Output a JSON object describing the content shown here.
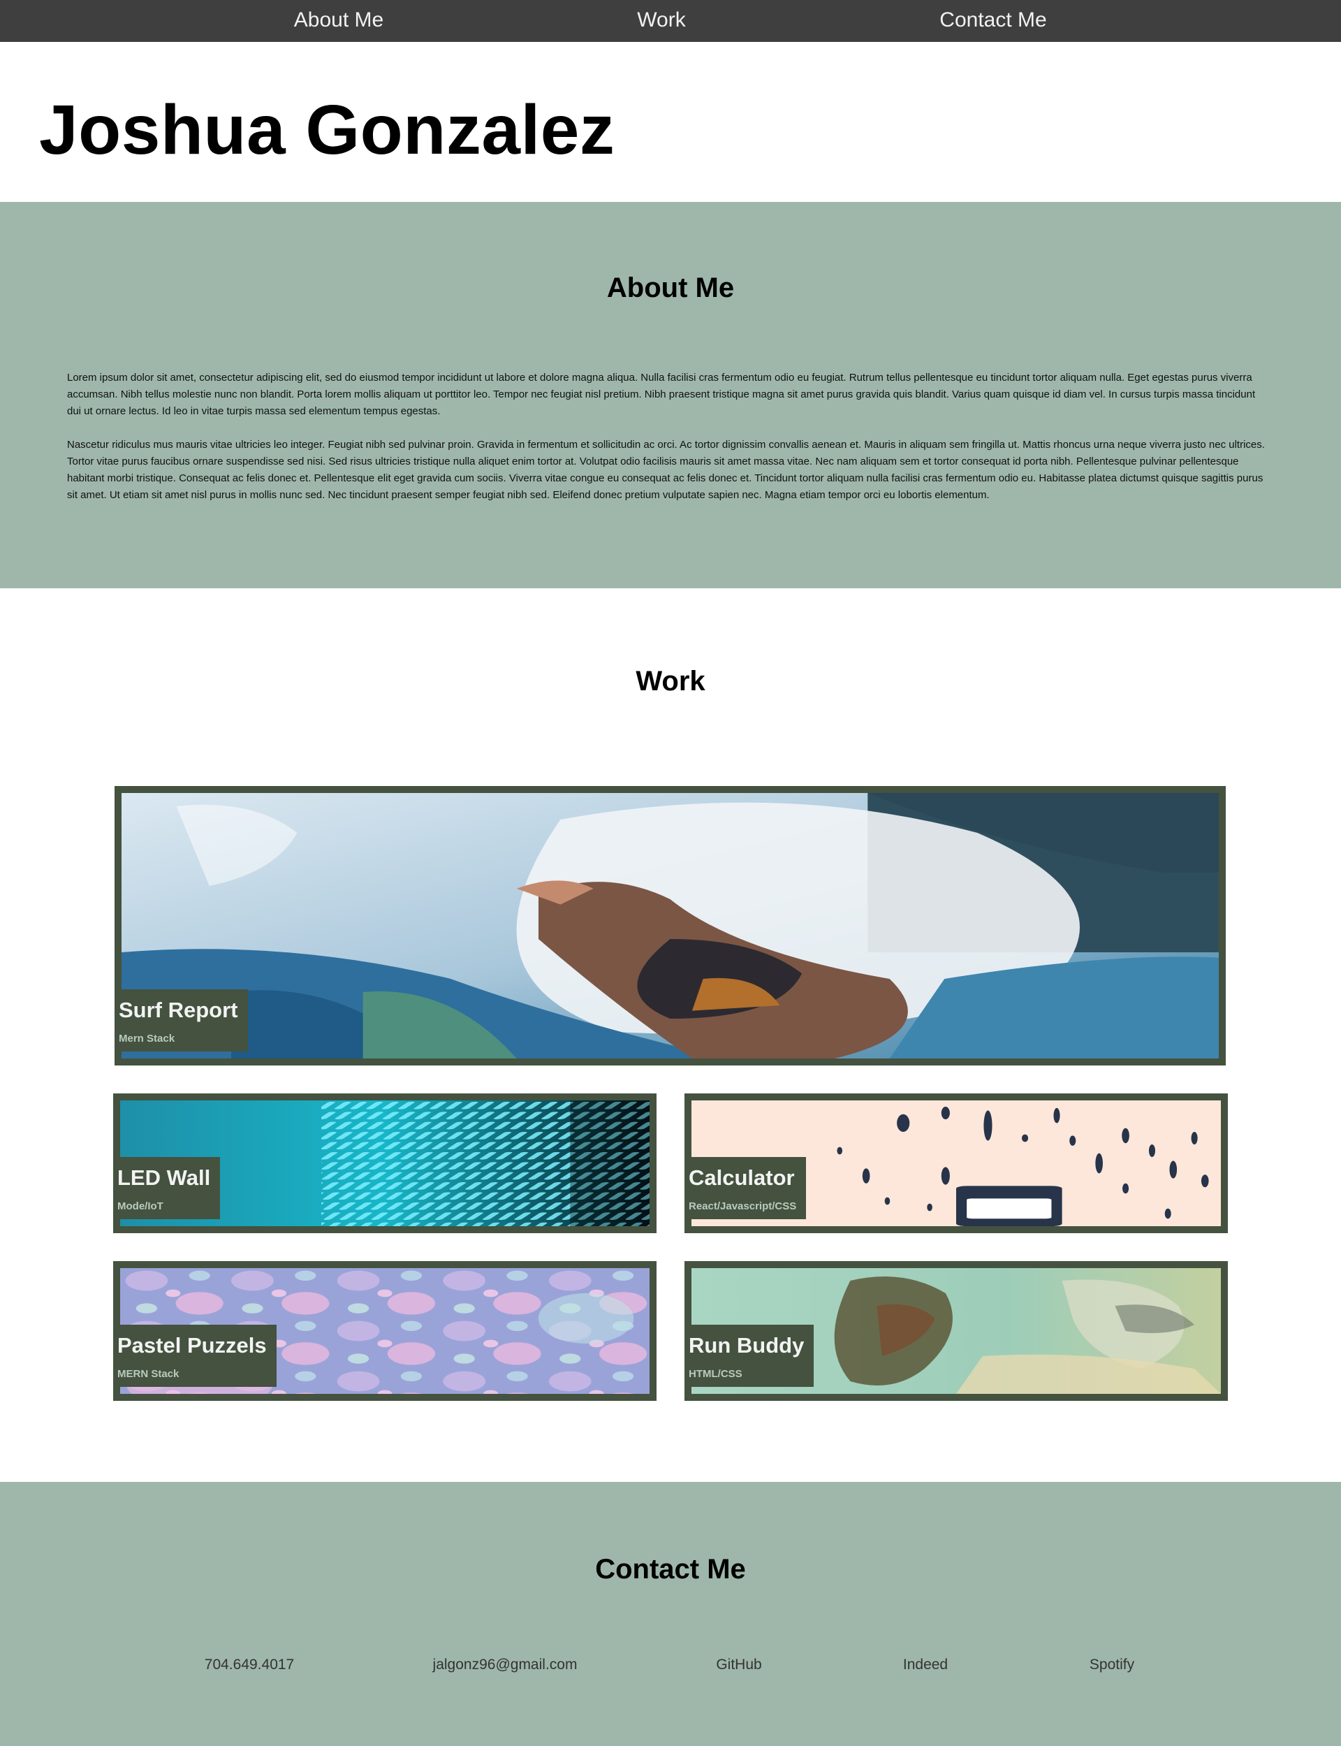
{
  "nav": {
    "items": [
      {
        "label": "About Me"
      },
      {
        "label": "Work"
      },
      {
        "label": "Contact Me"
      }
    ]
  },
  "header": {
    "name": "Joshua Gonzalez"
  },
  "about": {
    "title": "About Me",
    "paragraphs": [
      "Lorem ipsum dolor sit amet, consectetur adipiscing elit, sed do eiusmod tempor incididunt ut labore et dolore magna aliqua. Nulla facilisi cras fermentum odio eu feugiat. Rutrum tellus pellentesque eu tincidunt tortor aliquam nulla. Eget egestas purus viverra accumsan. Nibh tellus molestie nunc non blandit. Porta lorem mollis aliquam ut porttitor leo. Tempor nec feugiat nisl pretium. Nibh praesent tristique magna sit amet purus gravida quis blandit. Varius quam quisque id diam vel. In cursus turpis massa tincidunt dui ut ornare lectus. Id leo in vitae turpis massa sed elementum tempus egestas.",
      "Nascetur ridiculus mus mauris vitae ultricies leo integer. Feugiat nibh sed pulvinar proin. Gravida in fermentum et sollicitudin ac orci. Ac tortor dignissim convallis aenean et. Mauris in aliquam sem fringilla ut. Mattis rhoncus urna neque viverra justo nec ultrices. Tortor vitae purus faucibus ornare suspendisse sed nisi. Sed risus ultricies tristique nulla aliquet enim tortor at. Volutpat odio facilisis mauris sit amet massa vitae. Nec nam aliquam sem et tortor consequat id porta nibh. Pellentesque pulvinar pellentesque habitant morbi tristique. Consequat ac felis donec et. Pellentesque elit eget gravida cum sociis. Viverra vitae congue eu consequat ac felis donec et. Tincidunt tortor aliquam nulla facilisi cras fermentum odio eu. Habitasse platea dictumst quisque sagittis purus sit amet. Ut etiam sit amet nisl purus in mollis nunc sed. Nec tincidunt praesent semper feugiat nibh sed. Eleifend donec pretium vulputate sapien nec. Magna etiam tempor orci eu lobortis elementum."
    ]
  },
  "work": {
    "title": "Work",
    "projects": [
      {
        "title": "Surf Report",
        "stack": "Mern Stack"
      },
      {
        "title": "LED Wall",
        "stack": "Mode/IoT"
      },
      {
        "title": "Calculator",
        "stack": "React/Javascript/CSS"
      },
      {
        "title": "Pastel Puzzels",
        "stack": "MERN Stack"
      },
      {
        "title": "Run Buddy",
        "stack": "HTML/CSS"
      }
    ]
  },
  "contact": {
    "title": "Contact Me",
    "links": [
      {
        "label": "704.649.4017"
      },
      {
        "label": "jalgonz96@gmail.com"
      },
      {
        "label": "GitHub"
      },
      {
        "label": "Indeed"
      },
      {
        "label": "Spotify"
      }
    ]
  },
  "colors": {
    "nav_bg": "#3f3f3f",
    "section_bg": "#9eb7aa",
    "card_frame": "#44523f",
    "label_subtext": "#b9cbbf"
  }
}
